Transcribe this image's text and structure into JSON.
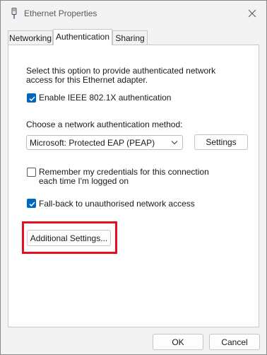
{
  "window": {
    "title": "Ethernet Properties",
    "icon": "network-adapter-icon"
  },
  "tabs": [
    {
      "label": "Networking",
      "active": false
    },
    {
      "label": "Authentication",
      "active": true
    },
    {
      "label": "Sharing",
      "active": false
    }
  ],
  "authentication": {
    "description": "Select this option to provide authenticated network access for this Ethernet adapter.",
    "enable_8021x": {
      "label": "Enable IEEE 802.1X authentication",
      "checked": true
    },
    "method_label": "Choose a network authentication method:",
    "method_select": {
      "value": "Microsoft: Protected EAP (PEAP)"
    },
    "settings_button": "Settings",
    "remember_credentials": {
      "label": "Remember my credentials for this connection each time I'm logged on",
      "checked": false
    },
    "fallback": {
      "label": "Fall-back to unauthorised network access",
      "checked": true
    },
    "additional_settings_button": "Additional Settings..."
  },
  "footer": {
    "ok_label": "OK",
    "cancel_label": "Cancel"
  },
  "colors": {
    "accent": "#0067c0",
    "highlight": "#e4101b"
  }
}
